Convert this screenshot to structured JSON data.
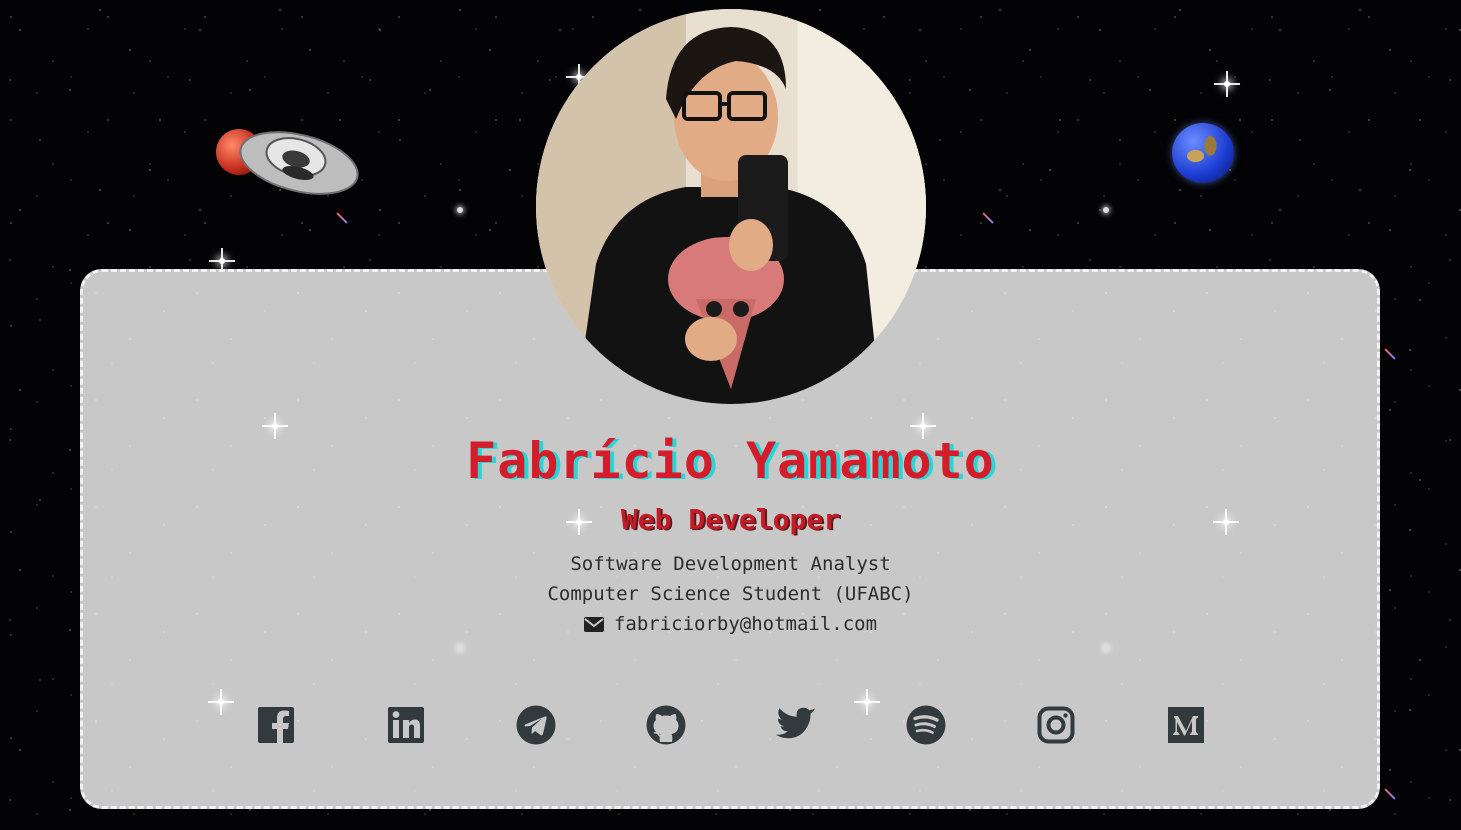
{
  "profile": {
    "name": "Fabrício Yamamoto",
    "role": "Web Developer",
    "lines": [
      "Software Development Analyst",
      "Computer Science Student (UFABC)"
    ],
    "email": "fabriciorby@hotmail.com"
  },
  "social_links": [
    {
      "name": "facebook",
      "icon": "facebook-icon"
    },
    {
      "name": "linkedin",
      "icon": "linkedin-icon"
    },
    {
      "name": "telegram",
      "icon": "telegram-icon"
    },
    {
      "name": "github",
      "icon": "github-icon"
    },
    {
      "name": "twitter",
      "icon": "twitter-icon"
    },
    {
      "name": "spotify",
      "icon": "spotify-icon"
    },
    {
      "name": "instagram",
      "icon": "instagram-icon"
    },
    {
      "name": "medium",
      "icon": "medium-icon"
    }
  ],
  "colors": {
    "name": "#d41c2a",
    "name_shadow": "#27d6d6",
    "role": "#c41c26",
    "card": "#c8c8c8",
    "icon": "#333a3d",
    "text": "#2c2c2c"
  }
}
